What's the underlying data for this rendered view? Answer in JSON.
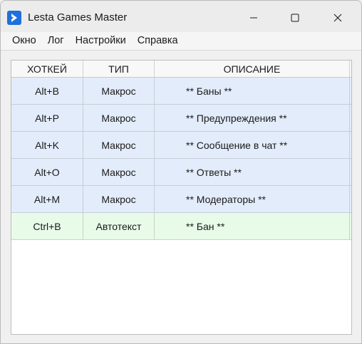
{
  "window": {
    "title": "Lesta Games Master",
    "controls": {
      "minimize": "—",
      "maximize": "☐",
      "close": "✕"
    }
  },
  "menu": {
    "items": [
      {
        "label": "Окно"
      },
      {
        "label": "Лог"
      },
      {
        "label": "Настройки"
      },
      {
        "label": "Справка"
      }
    ]
  },
  "table": {
    "columns": [
      "ХОТКЕЙ",
      "ТИП",
      "ОПИСАНИЕ"
    ],
    "rows": [
      {
        "hotkey": "Alt+B",
        "type": "Макрос",
        "description": "** Баны **",
        "kind": "macro"
      },
      {
        "hotkey": "Alt+P",
        "type": "Макрос",
        "description": "** Предупреждения **",
        "kind": "macro"
      },
      {
        "hotkey": "Alt+K",
        "type": "Макрос",
        "description": "** Сообщение в чат **",
        "kind": "macro"
      },
      {
        "hotkey": "Alt+O",
        "type": "Макрос",
        "description": "** Ответы **",
        "kind": "macro"
      },
      {
        "hotkey": "Alt+M",
        "type": "Макрос",
        "description": "** Модераторы **",
        "kind": "macro"
      },
      {
        "hotkey": "Ctrl+B",
        "type": "Автотекст",
        "description": "** Бан **",
        "kind": "autotext"
      }
    ]
  },
  "colors": {
    "macro_row": "#e3ecfa",
    "autotext_row": "#e8fbe8",
    "app_icon": "#1f6fdc"
  }
}
